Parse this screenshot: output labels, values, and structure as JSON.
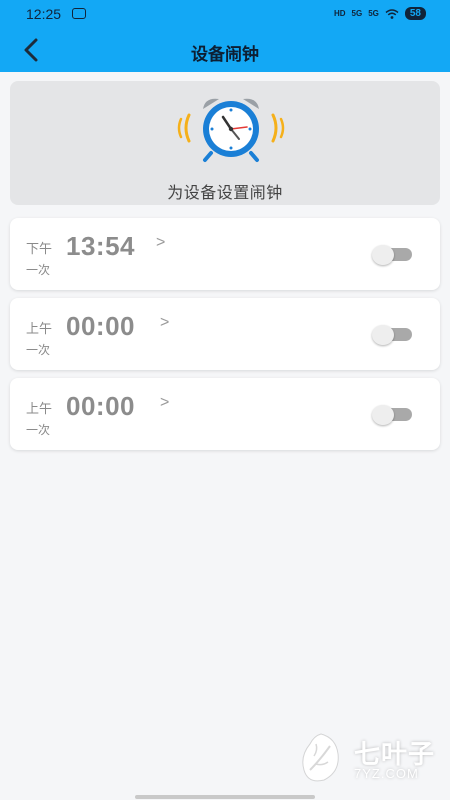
{
  "status_bar": {
    "time": "12:25",
    "network_labels": [
      "HD",
      "5G",
      "5G"
    ],
    "battery": "58"
  },
  "header": {
    "title": "设备闹钟",
    "back_icon": "chevron-left-icon",
    "background_color": "#13a8f5"
  },
  "banner": {
    "icon": "alarm-clock-icon",
    "text": "为设备设置闹钟"
  },
  "alarms": [
    {
      "period": "下午",
      "time": "13:54",
      "repeat": "一次",
      "enabled": false
    },
    {
      "period": "上午",
      "time": "00:00",
      "repeat": "一次",
      "enabled": false
    },
    {
      "period": "上午",
      "time": "00:00",
      "repeat": "一次",
      "enabled": false
    }
  ],
  "watermark": {
    "name": "七叶子",
    "domain": "7YZ.COM"
  }
}
